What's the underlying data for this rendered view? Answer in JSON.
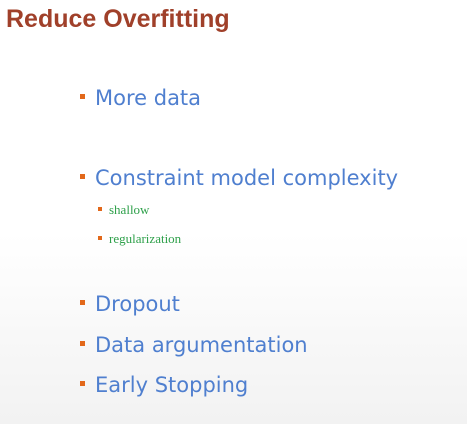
{
  "title": "Reduce Overfitting",
  "colors": {
    "title": "#a0402a",
    "bullet": "#e2681a",
    "item_text": "#4f7fcf",
    "sub_text": "#2ea04a"
  },
  "items": [
    {
      "label": "More data"
    },
    {
      "label": "Constraint model complexity",
      "subitems": [
        "shallow",
        "regularization"
      ]
    },
    {
      "label": "Dropout"
    },
    {
      "label": "Data argumentation"
    },
    {
      "label": "Early Stopping"
    }
  ]
}
